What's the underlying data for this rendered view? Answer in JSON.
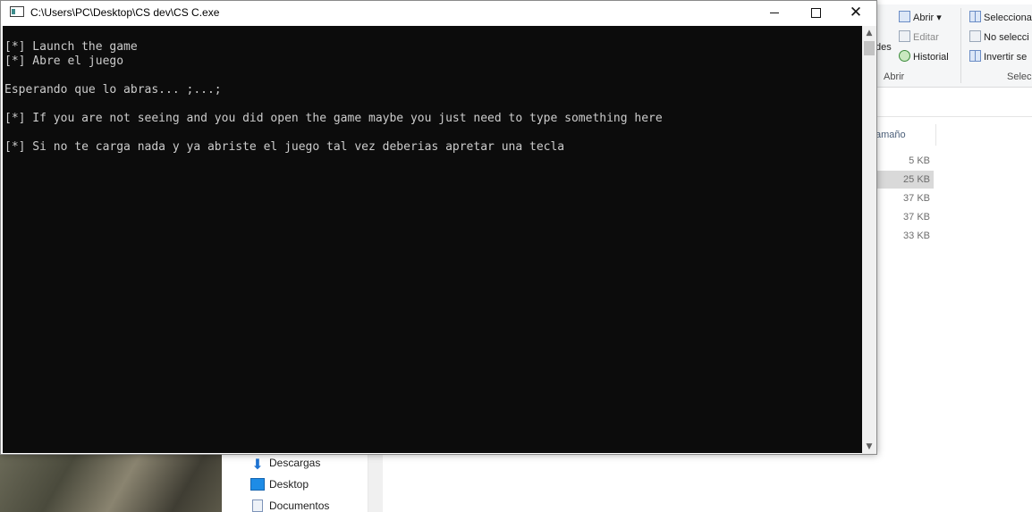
{
  "console": {
    "title": "C:\\Users\\PC\\Desktop\\CS dev\\CS C.exe",
    "lines": [
      "[*] Launch the game",
      "[*] Abre el juego",
      "",
      "Esperando que lo abras... ;...;",
      "",
      "[*] If you are not seeing and you did open the game maybe you just need to type something here",
      "",
      "[*] Si no te carga nada y ya abriste el juego tal vez deberias apretar una tecla"
    ]
  },
  "explorer": {
    "ribbon": {
      "partial_left": "des",
      "abrir": "Abrir",
      "editar": "Editar",
      "historial": "Historial",
      "group_abrir": "Abrir",
      "seleccionar": "Selecciona",
      "no_seleccionar": "No selecci",
      "invertir": "Invertir se",
      "group_selec": "Selecc"
    },
    "column_header": "amaño",
    "sizes": [
      "5 KB",
      "25 KB",
      "37 KB",
      "37 KB",
      "33 KB"
    ],
    "nav": {
      "descargas": "Descargas",
      "desktop": "Desktop",
      "documentos": "Documentos"
    }
  }
}
